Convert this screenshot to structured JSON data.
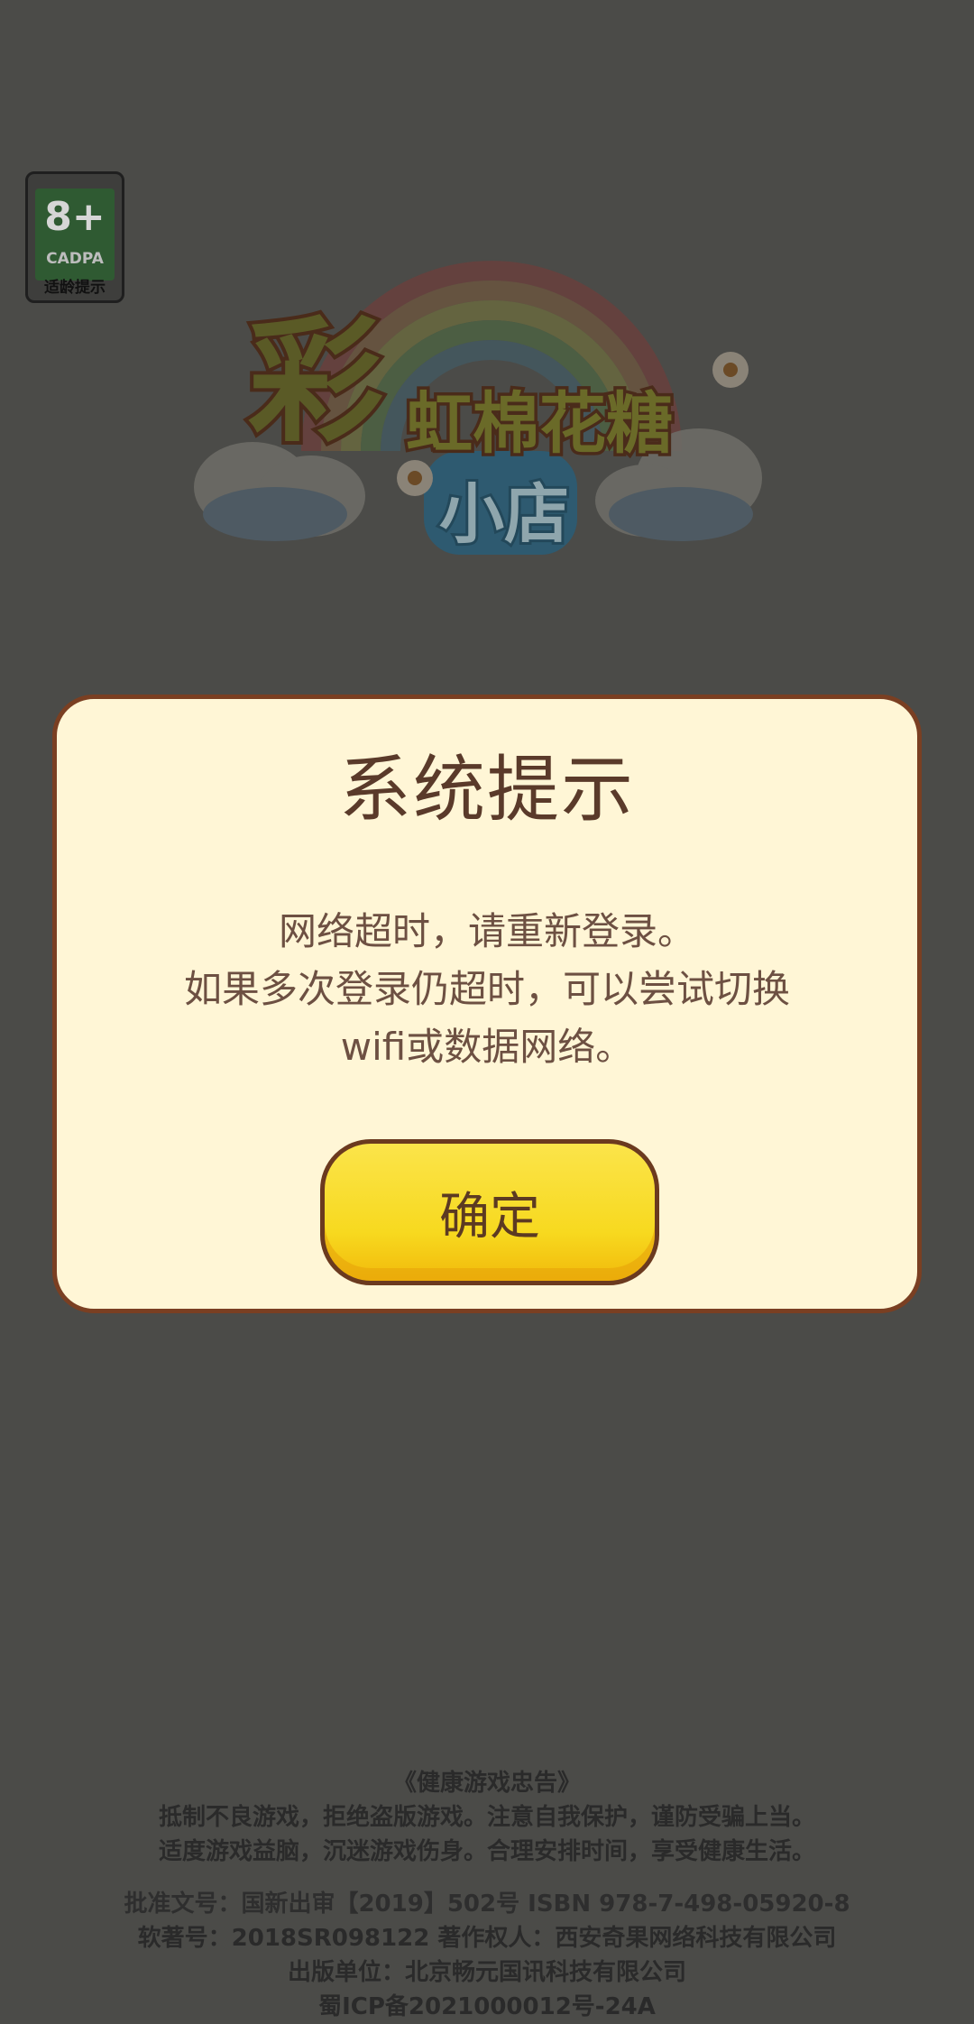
{
  "age_badge": {
    "age": "8+",
    "org": "CADPA",
    "tip": "适龄提示"
  },
  "logo": {
    "main_char": "彩",
    "line1": "虹棉花糖",
    "line2": "小店"
  },
  "dialog": {
    "title": "系统提示",
    "message_lines": [
      "网络超时，请重新登录。",
      "如果多次登录仍超时，可以尝试切换",
      "wifi或数据网络。"
    ],
    "confirm_label": "确定"
  },
  "footer": {
    "advisory": [
      "《健康游戏忠告》",
      "抵制不良游戏，拒绝盗版游戏。注意自我保护，谨防受骗上当。",
      "适度游戏益脑，沉迷游戏伤身。合理安排时间，享受健康生活。"
    ],
    "license": [
      "批准文号：国新出审【2019】502号 ISBN 978-7-498-05920-8",
      "软著号：2018SR098122 著作权人：西安奇果网络科技有限公司",
      "出版单位：北京畅元国讯科技有限公司",
      "蜀ICP备2021000012号-24A"
    ]
  },
  "colors": {
    "overlay_bg": "#4b4b48",
    "dialog_bg": "#fff6d6",
    "dialog_border": "#7a3f22",
    "button_yellow": "#f7d91f"
  }
}
